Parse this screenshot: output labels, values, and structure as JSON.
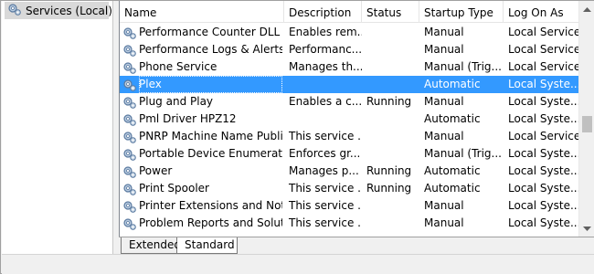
{
  "tree": {
    "item_label": "Services (Local)",
    "icon": "services-gear-icon"
  },
  "columns": {
    "name": "Name",
    "description": "Description",
    "status": "Status",
    "startup": "Startup Type",
    "logon": "Log On As"
  },
  "rows": [
    {
      "name": "Performance Counter DLL ...",
      "description": "Enables rem...",
      "status": "",
      "startup": "Manual",
      "logon": "Local Service",
      "selected": false
    },
    {
      "name": "Performance Logs & Alerts",
      "description": "Performanc...",
      "status": "",
      "startup": "Manual",
      "logon": "Local Service",
      "selected": false
    },
    {
      "name": "Phone Service",
      "description": "Manages th...",
      "status": "",
      "startup": "Manual (Trig...",
      "logon": "Local Service",
      "selected": false
    },
    {
      "name": "Plex",
      "description": "",
      "status": "",
      "startup": "Automatic",
      "logon": "Local Syste...",
      "selected": true
    },
    {
      "name": "Plug and Play",
      "description": "Enables a c...",
      "status": "Running",
      "startup": "Manual",
      "logon": "Local Syste...",
      "selected": false
    },
    {
      "name": "Pml Driver HPZ12",
      "description": "",
      "status": "",
      "startup": "Automatic",
      "logon": "Local Syste...",
      "selected": false
    },
    {
      "name": "PNRP Machine Name Publi...",
      "description": "This service ...",
      "status": "",
      "startup": "Manual",
      "logon": "Local Service",
      "selected": false
    },
    {
      "name": "Portable Device Enumerator...",
      "description": "Enforces gr...",
      "status": "",
      "startup": "Manual (Trig...",
      "logon": "Local Syste...",
      "selected": false
    },
    {
      "name": "Power",
      "description": "Manages p...",
      "status": "Running",
      "startup": "Automatic",
      "logon": "Local Syste...",
      "selected": false
    },
    {
      "name": "Print Spooler",
      "description": "This service ...",
      "status": "Running",
      "startup": "Automatic",
      "logon": "Local Syste...",
      "selected": false
    },
    {
      "name": "Printer Extensions and Notif...",
      "description": "This service ...",
      "status": "",
      "startup": "Manual",
      "logon": "Local Syste...",
      "selected": false
    },
    {
      "name": "Problem Reports and Soluti...",
      "description": "This service ...",
      "status": "",
      "startup": "Manual",
      "logon": "Local Syste...",
      "selected": false
    }
  ],
  "row_icon": "service-gear-icon",
  "tabs": {
    "extended": "Extended",
    "standard": "Standard",
    "active": "Standard"
  },
  "colors": {
    "selection": "#3399ff",
    "tree_selection": "#d9d9d9"
  }
}
